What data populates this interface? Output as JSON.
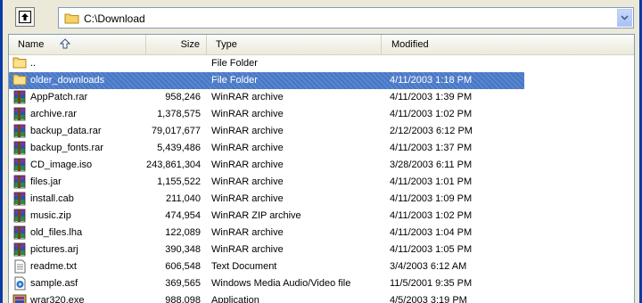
{
  "window": {
    "frame_color": "#0a3ba8"
  },
  "toolbar": {
    "up_button_icon": "up-folder-icon"
  },
  "path": {
    "value": "C:\\Download",
    "folder_icon": "folder-icon",
    "dropdown_icon": "chevron-down-icon"
  },
  "list": {
    "columns": {
      "name": "Name",
      "size": "Size",
      "type": "Type",
      "modified": "Modified"
    },
    "sort_icon": "sort-ascending-icon",
    "selected_color": "#316ac5",
    "rows": [
      {
        "icon": "folder",
        "name": "..",
        "size": "",
        "type": "File Folder",
        "modified": ""
      },
      {
        "icon": "folder",
        "name": "older_downloads",
        "size": "",
        "type": "File Folder",
        "modified": "4/11/2003 1:18 PM",
        "selected": true
      },
      {
        "icon": "rar",
        "name": "AppPatch.rar",
        "size": "958,246",
        "type": "WinRAR archive",
        "modified": "4/11/2003 1:39 PM"
      },
      {
        "icon": "rar",
        "name": "archive.rar",
        "size": "1,378,575",
        "type": "WinRAR archive",
        "modified": "4/11/2003 1:02 PM"
      },
      {
        "icon": "rar",
        "name": "backup_data.rar",
        "size": "79,017,677",
        "type": "WinRAR archive",
        "modified": "2/12/2003 6:12 PM"
      },
      {
        "icon": "rar",
        "name": "backup_fonts.rar",
        "size": "5,439,486",
        "type": "WinRAR archive",
        "modified": "4/11/2003 1:37 PM"
      },
      {
        "icon": "rar",
        "name": "CD_image.iso",
        "size": "243,861,304",
        "type": "WinRAR archive",
        "modified": "3/28/2003 6:11 PM"
      },
      {
        "icon": "rar",
        "name": "files.jar",
        "size": "1,155,522",
        "type": "WinRAR archive",
        "modified": "4/11/2003 1:01 PM"
      },
      {
        "icon": "rar",
        "name": "install.cab",
        "size": "211,040",
        "type": "WinRAR archive",
        "modified": "4/11/2003 1:09 PM"
      },
      {
        "icon": "rar",
        "name": "music.zip",
        "size": "474,954",
        "type": "WinRAR ZIP archive",
        "modified": "4/11/2003 1:02 PM"
      },
      {
        "icon": "rar",
        "name": "old_files.lha",
        "size": "122,089",
        "type": "WinRAR archive",
        "modified": "4/11/2003 1:04 PM"
      },
      {
        "icon": "rar",
        "name": "pictures.arj",
        "size": "390,348",
        "type": "WinRAR archive",
        "modified": "4/11/2003 1:05 PM"
      },
      {
        "icon": "text",
        "name": "readme.txt",
        "size": "606,548",
        "type": "Text Document",
        "modified": "3/4/2003 6:12 AM"
      },
      {
        "icon": "media",
        "name": "sample.asf",
        "size": "369,565",
        "type": "Windows Media Audio/Video file",
        "modified": "11/5/2001 9:35 PM"
      },
      {
        "icon": "exe",
        "name": "wrar320.exe",
        "size": "988,098",
        "type": "Application",
        "modified": "4/5/2003 3:19 PM"
      }
    ]
  }
}
